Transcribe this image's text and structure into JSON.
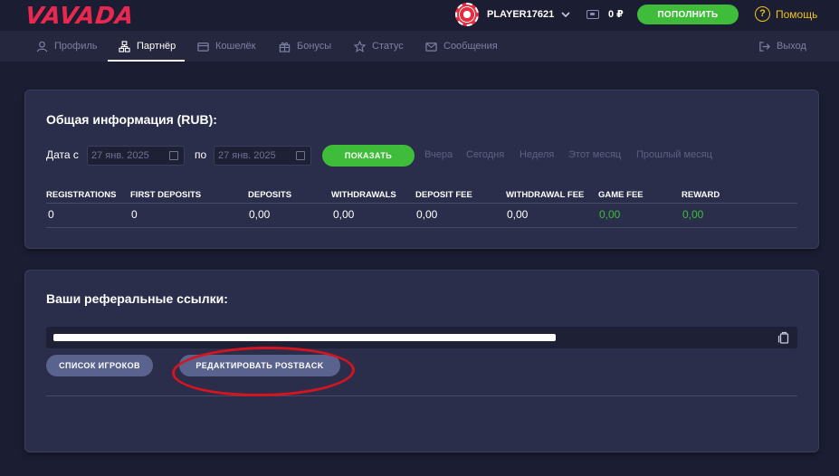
{
  "header": {
    "logo": "VAVADA",
    "username": "PLAYER17621",
    "balance": "0 ₽",
    "topup_label": "ПОПОЛНИТЬ",
    "help_label": "Помощь"
  },
  "nav": {
    "items": [
      {
        "label": "Профиль",
        "icon": "user-icon"
      },
      {
        "label": "Партнёр",
        "icon": "partner-icon",
        "active": true
      },
      {
        "label": "Кошелёк",
        "icon": "wallet-icon"
      },
      {
        "label": "Бонусы",
        "icon": "gift-icon"
      },
      {
        "label": "Статус",
        "icon": "star-icon"
      },
      {
        "label": "Сообщения",
        "icon": "mail-icon"
      }
    ],
    "logout_label": "Выход"
  },
  "summary": {
    "title": "Общая информация (RUB):",
    "date_from_label": "Дата с",
    "date_from_value": "27 янв.  2025",
    "date_to_label": "по",
    "date_to_value": "27 янв.  2025",
    "show_label": "ПОКАЗАТЬ",
    "periods": [
      "Вчера",
      "Сегодня",
      "Неделя",
      "Этот месяц",
      "Прошлый месяц"
    ],
    "columns": [
      "REGISTRATIONS",
      "FIRST DEPOSITS",
      "DEPOSITS",
      "WITHDRAWALS",
      "DEPOSIT FEE",
      "WITHDRAWAL FEE",
      "GAME FEE",
      "REWARD"
    ],
    "values": [
      "0",
      "0",
      "0,00",
      "0,00",
      "0,00",
      "0,00",
      "0,00",
      "0,00"
    ]
  },
  "referral": {
    "title": "Ваши реферальные ссылки:",
    "players_list_label": "СПИСОК ИГРОКОВ",
    "edit_postback_label": "РЕДАКТИРОВАТЬ POSTBACK"
  },
  "colors": {
    "background": "#1b1d33",
    "card": "#2b2e4b",
    "accent_green": "#3fbd3a",
    "brand_red": "#e8284f",
    "help_yellow": "#f0c419",
    "annotation_red": "#d6141f"
  }
}
